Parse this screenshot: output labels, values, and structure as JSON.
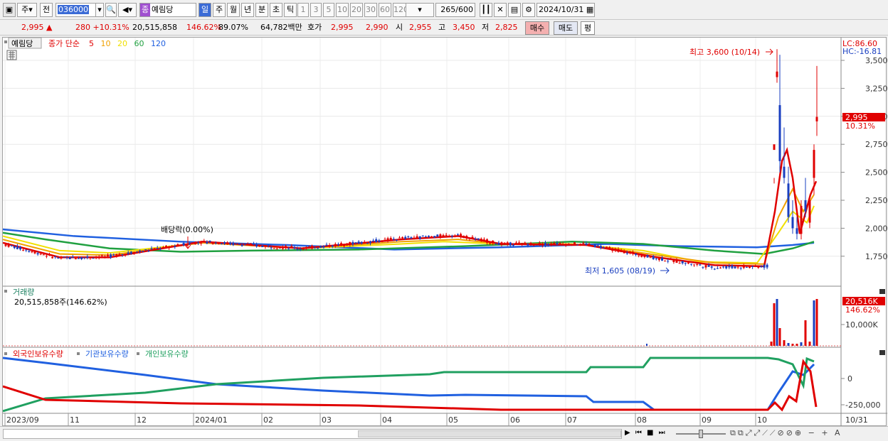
{
  "toolbar": {
    "period_type": "주",
    "prev_label": "전",
    "stock_code": "036000",
    "stock_tag": "종",
    "stock_name": "예림당",
    "intervals": [
      "일",
      "주",
      "월",
      "년",
      "분",
      "초",
      "틱"
    ],
    "selected_interval": "일",
    "minute_options": [
      "1",
      "3",
      "5",
      "10",
      "20",
      "30",
      "60",
      "120"
    ],
    "count_value": "265",
    "count_total": "/600",
    "date_value": "2024/10/31"
  },
  "quote": {
    "price": "2,995 ▲",
    "change": "280 +10.31%",
    "volume": "20,515,858",
    "volume_ratio": "146.62%",
    "turnover": "89.07%",
    "amount": "64,782백만",
    "ask_label": "호가",
    "ask_price": "2,995",
    "bid_price": "2,990",
    "open_label": "시",
    "open": "2,955",
    "high_label": "고",
    "high": "3,450",
    "low_label": "저",
    "low": "2,825",
    "buy_label": "매수",
    "sell_label": "매도",
    "eval_label": "평"
  },
  "legend": {
    "stock_name": "예림당",
    "ma_prefix": "종가 단순",
    "ma_periods": [
      "5",
      "10",
      "20",
      "60",
      "120"
    ]
  },
  "price_axis": {
    "lc": "LC:86.60",
    "hc": "HC:-16.81",
    "ticks": [
      "3,500",
      "3,250",
      "3,000",
      "2,750",
      "2,500",
      "2,250",
      "2,000",
      "1,750"
    ],
    "current_price": "2,995",
    "current_change": "10.31%"
  },
  "annotations": {
    "high_label": "최고 3,600 (10/14)",
    "low_label": "최저 1,605 (08/19)",
    "dividend_label": "배당락(0.00%)"
  },
  "volume_panel": {
    "title": "거래량",
    "value_label": "20,515,858주(146.62%)",
    "current": "20,516K",
    "ratio": "146.62%",
    "tick": "10,000K"
  },
  "holding_panel": {
    "series": [
      "외국인보유수량",
      "기관보유수량",
      "개인보유수량"
    ],
    "ticks": [
      "0",
      "-250,000"
    ]
  },
  "date_axis": {
    "labels": [
      "2023/09",
      "11",
      "12",
      "2024/01",
      "02",
      "03",
      "04",
      "05",
      "06",
      "07",
      "08",
      "09",
      "10"
    ],
    "last_label": "10/31"
  },
  "colors": {
    "up": "#e00000",
    "down": "#1a3fc0",
    "ma5": "#e00000",
    "ma10": "#f0a000",
    "ma20": "#f0e000",
    "ma60": "#20a040",
    "ma120": "#2060e0",
    "foreign": "#e00000",
    "institution": "#2060e0",
    "individual": "#20a060"
  }
}
